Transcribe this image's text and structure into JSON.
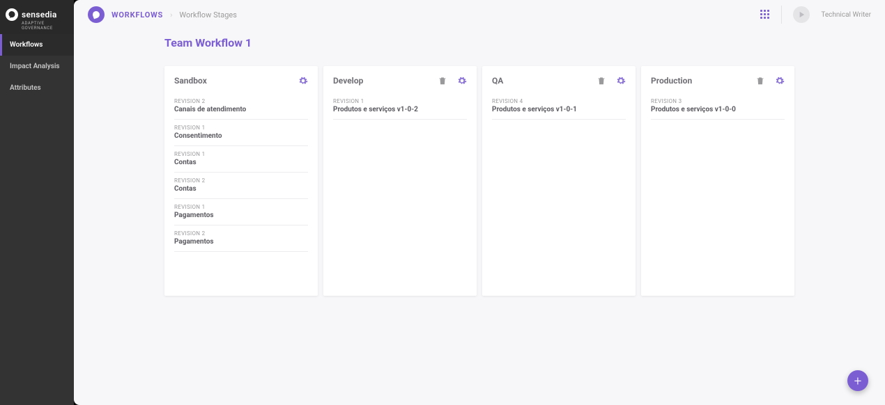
{
  "brand": {
    "name": "sensedia",
    "tagline_line1": "ADAPTIVE",
    "tagline_line2": "GOVERNANCE"
  },
  "sidebar": {
    "items": [
      {
        "label": "Workflows",
        "active": true
      },
      {
        "label": "Impact Analysis",
        "active": false
      },
      {
        "label": "Attributes",
        "active": false
      }
    ]
  },
  "breadcrumb": {
    "root": "WORKFLOWS",
    "current": "Workflow Stages"
  },
  "user": {
    "name": "Technical Writer"
  },
  "page": {
    "title": "Team Workflow 1"
  },
  "columns": [
    {
      "title": "Sandbox",
      "has_delete": false,
      "has_settings": true,
      "cards": [
        {
          "revision": "REVISION 2",
          "name": "Canais de atendimento"
        },
        {
          "revision": "REVISION 1",
          "name": "Consentimento"
        },
        {
          "revision": "REVISION 1",
          "name": "Contas"
        },
        {
          "revision": "REVISION 2",
          "name": "Contas"
        },
        {
          "revision": "REVISION 1",
          "name": "Pagamentos"
        },
        {
          "revision": "REVISION 2",
          "name": "Pagamentos"
        }
      ]
    },
    {
      "title": "Develop",
      "has_delete": true,
      "has_settings": true,
      "cards": [
        {
          "revision": "REVISION 1",
          "name": "Produtos e serviços v1-0-2"
        }
      ]
    },
    {
      "title": "QA",
      "has_delete": true,
      "has_settings": true,
      "cards": [
        {
          "revision": "REVISION 4",
          "name": "Produtos e serviços v1-0-1"
        }
      ]
    },
    {
      "title": "Production",
      "has_delete": true,
      "has_settings": true,
      "cards": [
        {
          "revision": "REVISION 3",
          "name": "Produtos e serviços v1-0-0"
        }
      ]
    }
  ],
  "fab": {
    "label": "+"
  }
}
